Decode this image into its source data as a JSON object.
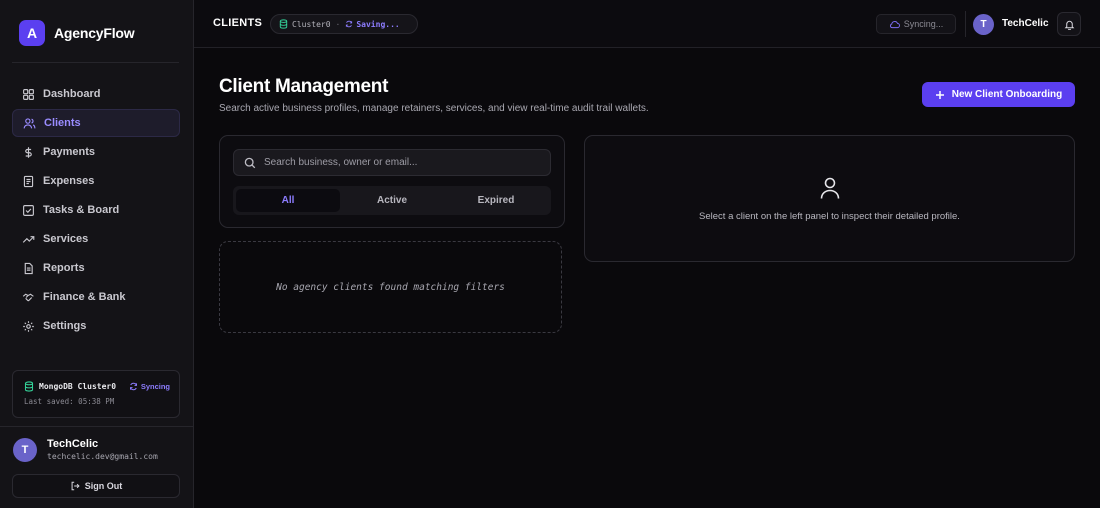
{
  "brand": {
    "logo_letter": "A",
    "name": "AgencyFlow",
    "accent": "#5b3ff0"
  },
  "sidebar": {
    "items": [
      {
        "label": "Dashboard",
        "icon": "grid-icon",
        "active": false
      },
      {
        "label": "Clients",
        "icon": "users-icon",
        "active": true
      },
      {
        "label": "Payments",
        "icon": "dollar-icon",
        "active": false
      },
      {
        "label": "Expenses",
        "icon": "receipt-icon",
        "active": false
      },
      {
        "label": "Tasks & Board",
        "icon": "checkbox-icon",
        "active": false
      },
      {
        "label": "Services",
        "icon": "trending-icon",
        "active": false
      },
      {
        "label": "Reports",
        "icon": "file-text-icon",
        "active": false
      },
      {
        "label": "Finance & Bank",
        "icon": "handshake-icon",
        "active": false
      },
      {
        "label": "Settings",
        "icon": "gear-icon",
        "active": false
      }
    ],
    "db_status": {
      "name": "MongoDB Cluster0",
      "status": "Syncing",
      "last_saved": "Last saved: 05:38 PM"
    },
    "user": {
      "initial": "T",
      "name": "TechCelic",
      "email": "techcelic.dev@gmail.com"
    },
    "signout_label": "Sign Out"
  },
  "topbar": {
    "crumb": "CLIENTS",
    "cluster": "Cluster0",
    "separator": "·",
    "saving": "Saving...",
    "sync_status": "Syncing...",
    "user_initial": "T",
    "user_name": "TechCelic"
  },
  "main": {
    "title": "Client Management",
    "subtitle": "Search active business profiles, manage retainers, services, and view real-time audit trail wallets.",
    "new_button": "New Client Onboarding",
    "search_placeholder": "Search business, owner or email...",
    "filters": [
      {
        "label": "All",
        "active": true
      },
      {
        "label": "Active",
        "active": false
      },
      {
        "label": "Expired",
        "active": false
      }
    ],
    "empty_text": "No agency clients found matching filters",
    "detail_text": "Select a client on the left panel to inspect their detailed profile."
  }
}
